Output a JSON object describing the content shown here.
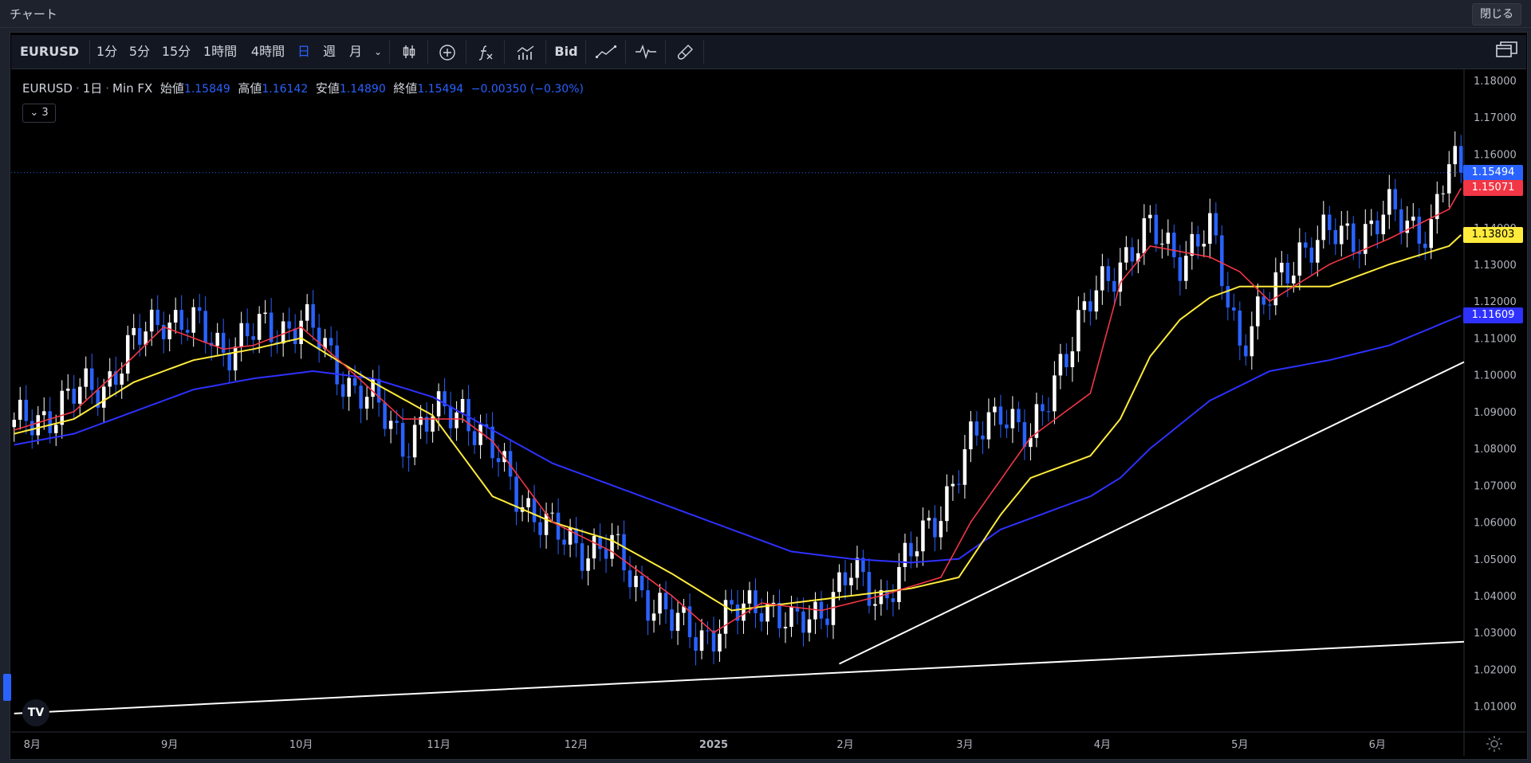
{
  "window": {
    "title": "チャート",
    "close_label": "閉じる"
  },
  "toolbar": {
    "symbol": "EURUSD",
    "timeframes": [
      "1分",
      "5分",
      "15分",
      "1時間",
      "4時間",
      "日",
      "週",
      "月"
    ],
    "active_timeframe": "日",
    "bid_label": "Bid",
    "icons": [
      "candlestick-icon",
      "add-indicator-icon",
      "formula-icon",
      "bars-chart-icon",
      "trendline-icon",
      "oscillator-icon",
      "brush-icon",
      "layout-icon"
    ]
  },
  "legend": {
    "symbol": "EURUSD",
    "interval": "1日",
    "source": "Min FX",
    "open_label": "始値",
    "open": "1.15849",
    "high_label": "高値",
    "high": "1.16142",
    "low_label": "安値",
    "low": "1.14890",
    "close_label": "終値",
    "close": "1.15494",
    "change": "−0.00350 (−0.30%)",
    "collapsed_count": "3"
  },
  "price_tags": [
    {
      "text": "1.15494",
      "price": 1.15494,
      "bg": "#2962ff",
      "fg": "#ffffff"
    },
    {
      "text": "1.15071",
      "price": 1.15071,
      "bg": "#f23645",
      "fg": "#ffffff"
    },
    {
      "text": "1.13803",
      "price": 1.13803,
      "bg": "#ffeb3b",
      "fg": "#000000"
    },
    {
      "text": "1.11609",
      "price": 1.11609,
      "bg": "#2e31ff",
      "fg": "#ffffff"
    }
  ],
  "colors": {
    "up": "#ffffff",
    "down": "#2962ff",
    "ma_fast": "#f23645",
    "ma_mid": "#ffeb3b",
    "ma_slow": "#2e31ff",
    "trendline": "#ffffff"
  },
  "chart_data": {
    "type": "line",
    "title": "EURUSD · 1日 · Min FX",
    "y_ticks": [
      "1.18000",
      "1.17000",
      "1.16000",
      "1.15000",
      "1.14000",
      "1.13000",
      "1.12000",
      "1.11000",
      "1.10000",
      "1.09000",
      "1.08000",
      "1.07000",
      "1.06000",
      "1.05000",
      "1.04000",
      "1.03000",
      "1.02000",
      "1.01000"
    ],
    "y_tick_values": [
      1.18,
      1.17,
      1.16,
      1.15,
      1.14,
      1.13,
      1.12,
      1.11,
      1.1,
      1.09,
      1.08,
      1.07,
      1.06,
      1.05,
      1.04,
      1.03,
      1.02,
      1.01
    ],
    "ylim": [
      1.003,
      1.183
    ],
    "x_ticks": [
      "8月",
      "9月",
      "10月",
      "11月",
      "12月",
      "2025",
      "2月",
      "3月",
      "4月",
      "5月",
      "6月"
    ],
    "x_tick_index": [
      3,
      26,
      48,
      71,
      94,
      117,
      139,
      159,
      182,
      205,
      228
    ],
    "n_bars": 243,
    "series": [
      {
        "name": "close",
        "x": [
          0,
          15,
          25,
          35,
          48,
          55,
          65,
          75,
          80,
          90,
          100,
          110,
          117,
          125,
          130,
          140,
          145,
          150,
          160,
          165,
          170,
          175,
          185,
          190,
          195,
          200,
          205,
          210,
          215,
          225,
          230,
          237,
          240,
          242
        ],
        "values": [
          1.085,
          1.098,
          1.117,
          1.108,
          1.115,
          1.1,
          1.083,
          1.092,
          1.078,
          1.056,
          1.052,
          1.032,
          1.03,
          1.04,
          1.03,
          1.045,
          1.04,
          1.05,
          1.08,
          1.093,
          1.08,
          1.105,
          1.132,
          1.138,
          1.133,
          1.138,
          1.11,
          1.12,
          1.135,
          1.139,
          1.143,
          1.14,
          1.156,
          1.15494
        ]
      },
      {
        "name": "ma-fast",
        "x": [
          0,
          10,
          20,
          25,
          35,
          40,
          48,
          55,
          65,
          75,
          80,
          90,
          100,
          110,
          117,
          125,
          135,
          145,
          155,
          160,
          170,
          180,
          185,
          190,
          200,
          205,
          210,
          220,
          230,
          240,
          242
        ],
        "values": [
          1.085,
          1.09,
          1.105,
          1.113,
          1.107,
          1.108,
          1.113,
          1.103,
          1.088,
          1.088,
          1.082,
          1.06,
          1.052,
          1.04,
          1.03,
          1.038,
          1.036,
          1.04,
          1.045,
          1.06,
          1.083,
          1.095,
          1.125,
          1.135,
          1.132,
          1.128,
          1.12,
          1.13,
          1.137,
          1.145,
          1.15071
        ]
      },
      {
        "name": "ma-mid",
        "x": [
          0,
          10,
          20,
          30,
          40,
          48,
          60,
          70,
          80,
          90,
          100,
          110,
          120,
          130,
          140,
          150,
          158,
          165,
          170,
          180,
          185,
          190,
          195,
          200,
          205,
          210,
          220,
          230,
          240,
          242
        ],
        "values": [
          1.084,
          1.088,
          1.098,
          1.104,
          1.107,
          1.11,
          1.098,
          1.089,
          1.067,
          1.06,
          1.055,
          1.046,
          1.036,
          1.038,
          1.04,
          1.042,
          1.045,
          1.062,
          1.072,
          1.078,
          1.088,
          1.105,
          1.115,
          1.121,
          1.124,
          1.124,
          1.124,
          1.13,
          1.135,
          1.13803
        ]
      },
      {
        "name": "ma-slow",
        "x": [
          0,
          10,
          20,
          30,
          40,
          50,
          55,
          60,
          70,
          80,
          90,
          100,
          110,
          120,
          130,
          140,
          150,
          158,
          165,
          175,
          180,
          185,
          190,
          200,
          210,
          220,
          230,
          242
        ],
        "values": [
          1.081,
          1.084,
          1.09,
          1.096,
          1.099,
          1.101,
          1.1,
          1.099,
          1.094,
          1.085,
          1.076,
          1.07,
          1.064,
          1.058,
          1.052,
          1.05,
          1.049,
          1.05,
          1.058,
          1.064,
          1.067,
          1.072,
          1.08,
          1.093,
          1.101,
          1.104,
          1.108,
          1.11609
        ]
      },
      {
        "name": "trendline-1",
        "x": [
          0,
          243
        ],
        "values": [
          1.008,
          1.0275
        ]
      },
      {
        "name": "trendline-2",
        "x": [
          138,
          243
        ],
        "values": [
          1.0215,
          1.1035
        ]
      }
    ]
  }
}
